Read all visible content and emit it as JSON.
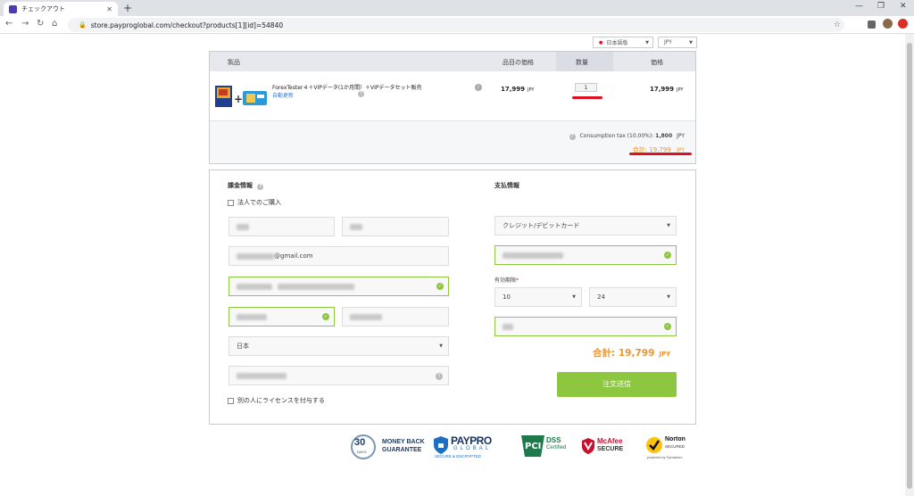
{
  "browser": {
    "tab_title": "チェックアウト",
    "url": "store.payproglobal.com/checkout?products[1][id]=54840"
  },
  "top_selectors": {
    "language": "日本語版",
    "currency": "JPY"
  },
  "cart": {
    "headers": {
      "product": "製品",
      "unit_price": "品目の価格",
      "quantity": "数量",
      "price": "価格"
    },
    "item": {
      "name": "ForexTester４＋VIPデータ(1か月間）＋VIPデータセット販売",
      "subscription": "自動更新",
      "unit_price": "17,999",
      "unit_currency": "JPY",
      "quantity": "1",
      "price": "17,999",
      "price_currency": "JPY"
    },
    "tax_label": "Consumption tax (10.00%):",
    "tax_value": "1,800",
    "tax_currency": "JPY",
    "total_label": "合計: 19,799",
    "total_currency": "JPY"
  },
  "billing": {
    "title": "課金情報",
    "corporate_checkbox": "法人でのご購入",
    "email_suffix": "@gmail.com",
    "country": "日本",
    "license_checkbox": "別の人にライセンスを付与する"
  },
  "payment": {
    "title": "支払情報",
    "method": "クレジット/デビットカード",
    "expiry_label": "有効期限",
    "expiry_required": "*",
    "month": "10",
    "year": "24",
    "grand_total": "合計: 19,799",
    "grand_currency": "JPY",
    "submit": "注文送信"
  },
  "trust_badges": {
    "days_number": "30",
    "days_label": "DAYS",
    "money_back": "MONEY BACK",
    "guarantee": "GUARANTEE",
    "paypro": "PAYPRO",
    "global": "GLOBAL",
    "secure_enc": "SECURE & ENCRYPTED",
    "dss": "DSS",
    "certified": "Certified",
    "mcafee": "McAfee",
    "mcafee_secure": "SECURE",
    "norton": "Norton",
    "norton_secured": "SECURED",
    "symantec": "powered by Symantec"
  }
}
